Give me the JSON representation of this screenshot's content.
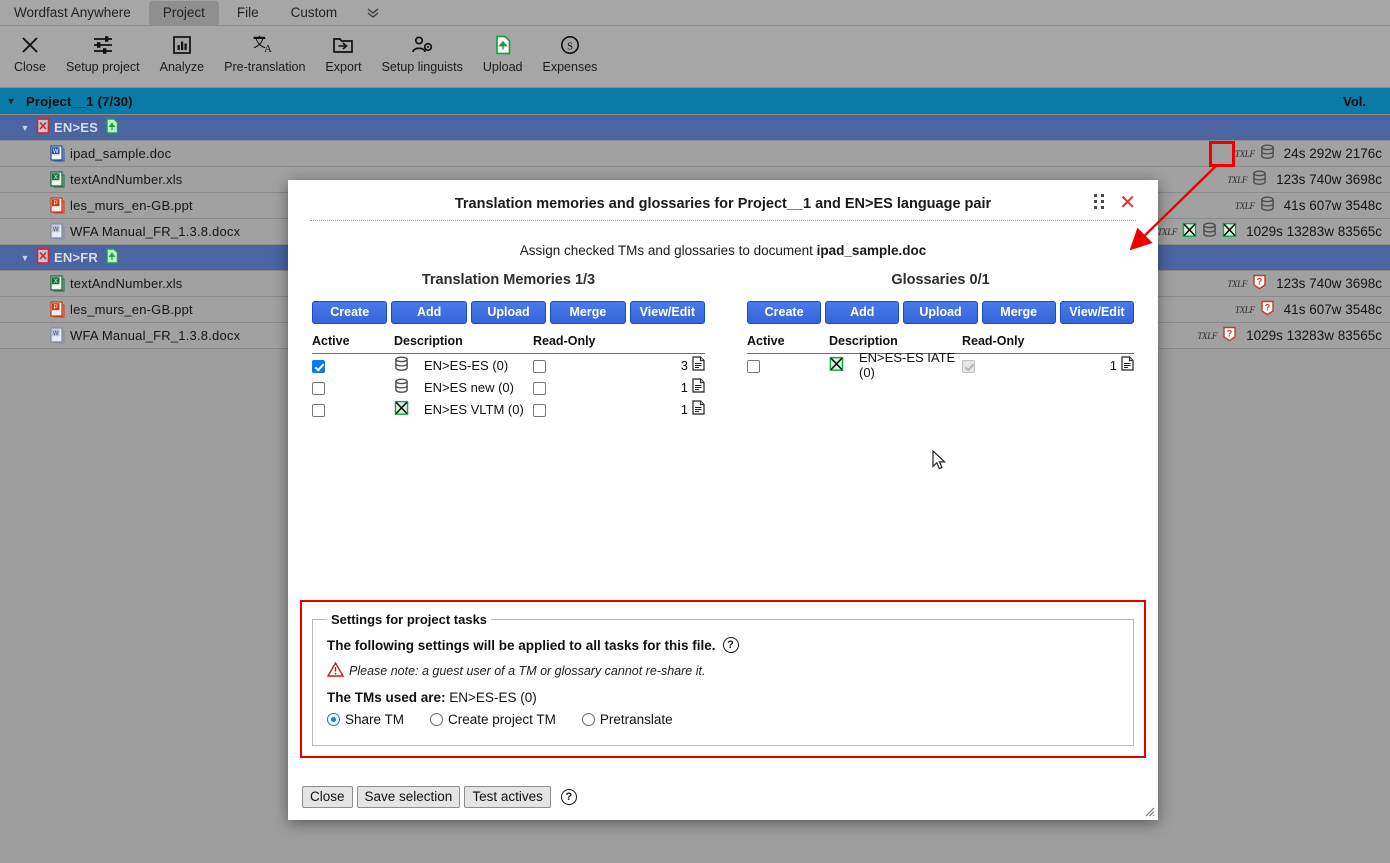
{
  "menubar": {
    "brand": "Wordfast Anywhere",
    "items": [
      {
        "label": "Project",
        "active": true
      },
      {
        "label": "File",
        "active": false
      },
      {
        "label": "Custom",
        "active": false
      }
    ],
    "overflow_icon": "chevron-double-down-icon"
  },
  "toolbar": {
    "items": [
      {
        "label": "Close",
        "icon": "close-x-icon"
      },
      {
        "label": "Setup project",
        "icon": "sliders-icon"
      },
      {
        "label": "Analyze",
        "icon": "bar-chart-icon"
      },
      {
        "label": "Pre-translation",
        "icon": "translate-icon"
      },
      {
        "label": "Export",
        "icon": "folder-export-icon"
      },
      {
        "label": "Setup linguists",
        "icon": "user-gear-icon"
      },
      {
        "label": "Upload",
        "icon": "upload-file-icon"
      },
      {
        "label": "Expenses",
        "icon": "dollar-circle-icon"
      }
    ]
  },
  "tree": {
    "vol_header": "Vol.",
    "project": {
      "label": "Project__1  (7/30)",
      "count": "(7/30)"
    },
    "groups": [
      {
        "lang": "EN>ES",
        "files": [
          {
            "name": "ipad_sample.doc",
            "type_icon": "word-doc-icon",
            "format": "TXLF",
            "status_icons": [
              "tm-database-icon"
            ],
            "vol": "24s 292w 2176c",
            "highlighted": true
          },
          {
            "name": "textAndNumber.xls",
            "type_icon": "excel-doc-icon",
            "format": "TXLF",
            "status_icons": [
              "tm-database-icon"
            ],
            "vol": "123s 740w 3698c",
            "highlighted": false
          },
          {
            "name": "les_murs_en-GB.ppt",
            "type_icon": "powerpoint-doc-icon",
            "format": "TXLF",
            "status_icons": [
              "tm-database-icon"
            ],
            "vol": "41s 607w 3548c",
            "highlighted": false
          },
          {
            "name": "WFA Manual_FR_1.3.8.docx",
            "type_icon": "word-docx-icon",
            "format": "TXLF",
            "status_icons": [
              "glossary-green-icon",
              "tm-database-icon",
              "glossary-green-icon"
            ],
            "vol": "1029s 13283w 83565c",
            "highlighted": false
          }
        ]
      },
      {
        "lang": "EN>FR",
        "files": [
          {
            "name": "textAndNumber.xls",
            "type_icon": "excel-doc-icon",
            "format": "TXLF",
            "status_icons": [
              "question-unknown-icon"
            ],
            "vol": "123s 740w 3698c",
            "highlighted": false
          },
          {
            "name": "les_murs_en-GB.ppt",
            "type_icon": "powerpoint-doc-icon",
            "format": "TXLF",
            "status_icons": [
              "question-unknown-icon"
            ],
            "vol": "41s 607w 3548c",
            "highlighted": false
          },
          {
            "name": "WFA Manual_FR_1.3.8.docx",
            "type_icon": "word-docx-icon",
            "format": "TXLF",
            "status_icons": [
              "question-unknown-icon"
            ],
            "vol": "1029s 13283w 83565c",
            "highlighted": false
          }
        ]
      }
    ]
  },
  "dialog": {
    "title": "Translation memories and glossaries for Project__1 and EN>ES language pair",
    "grip_icon": "drag-handle-icon",
    "close_icon": "close-x-icon",
    "assign_prefix": "Assign checked TMs and glossaries to document ",
    "assign_document": "ipad_sample.doc",
    "tm_panel": {
      "title": "Translation Memories 1/3",
      "buttons": [
        "Create",
        "Add",
        "Upload",
        "Merge",
        "View/Edit"
      ],
      "headers": {
        "active": "Active",
        "description": "Description",
        "readonly": "Read-Only"
      },
      "rows": [
        {
          "active": true,
          "icon": "tm-database-icon",
          "description": "EN>ES-ES (0)",
          "readonly": false,
          "readonly_disabled": false,
          "count": "3"
        },
        {
          "active": false,
          "icon": "tm-database-icon",
          "description": "EN>ES new (0)",
          "readonly": false,
          "readonly_disabled": false,
          "count": "1"
        },
        {
          "active": false,
          "icon": "glossary-green-icon",
          "description": "EN>ES VLTM (0)",
          "readonly": false,
          "readonly_disabled": false,
          "count": "1"
        }
      ]
    },
    "gl_panel": {
      "title": "Glossaries 0/1",
      "buttons": [
        "Create",
        "Add",
        "Upload",
        "Merge",
        "View/Edit"
      ],
      "headers": {
        "active": "Active",
        "description": "Description",
        "readonly": "Read-Only"
      },
      "rows": [
        {
          "active": false,
          "icon": "glossary-green-icon",
          "description": "EN>ES-ES IATE (0)",
          "readonly": true,
          "readonly_disabled": true,
          "count": "1"
        }
      ]
    },
    "settings": {
      "legend": "Settings for project tasks",
      "applied_text": "The following settings will be applied to all tasks for this file.",
      "help_icon": "question-circle-icon",
      "warning_icon": "warning-triangle-icon",
      "note": "Please note: a guest user of a TM or glossary cannot re-share it.",
      "tms_label": "The TMs used are:",
      "tms_value": "EN>ES-ES (0)",
      "options": [
        {
          "label": "Share TM",
          "selected": true
        },
        {
          "label": "Create project TM",
          "selected": false
        },
        {
          "label": "Pretranslate",
          "selected": false
        }
      ]
    },
    "footer": {
      "buttons": [
        "Close",
        "Save selection",
        "Test actives"
      ],
      "help_icon": "question-circle-icon"
    }
  },
  "annotations": {
    "highlight_color": "#ef0000",
    "arrow_color": "#ef0000",
    "cursor_icon": "mouse-pointer-icon"
  }
}
